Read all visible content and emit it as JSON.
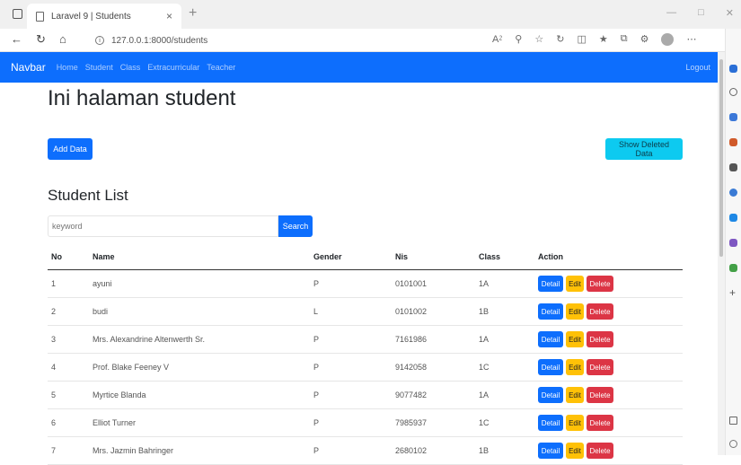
{
  "browser": {
    "tab_title": "Laravel 9 | Students",
    "tab_close": "×",
    "new_tab": "+",
    "url": "127.0.0.1:8000/students"
  },
  "navbar": {
    "brand": "Navbar",
    "links": [
      "Home",
      "Student",
      "Class",
      "Extracurricular",
      "Teacher"
    ],
    "logout": "Logout"
  },
  "page": {
    "title": "Ini halaman student",
    "add_button": "Add Data",
    "deleted_button": "Show Deleted Data",
    "section_title": "Student List",
    "search_placeholder": "keyword",
    "search_button": "Search"
  },
  "table": {
    "headers": [
      "No",
      "Name",
      "Gender",
      "Nis",
      "Class",
      "Action"
    ],
    "actions": {
      "detail": "Detail",
      "edit": "Edit",
      "delete": "Delete"
    },
    "rows": [
      [
        "1",
        "ayuni",
        "P",
        "0101001",
        "1A"
      ],
      [
        "2",
        "budi",
        "L",
        "0101002",
        "1B"
      ],
      [
        "3",
        "Mrs. Alexandrine Altenwerth Sr.",
        "P",
        "7161986",
        "1A"
      ],
      [
        "4",
        "Prof. Blake Feeney V",
        "P",
        "9142058",
        "1C"
      ],
      [
        "5",
        "Myrtice Blanda",
        "P",
        "9077482",
        "1A"
      ],
      [
        "6",
        "Elliot Turner",
        "P",
        "7985937",
        "1C"
      ],
      [
        "7",
        "Mrs. Jazmin Bahringer",
        "P",
        "2680102",
        "1B"
      ]
    ]
  },
  "colors": {
    "primary": "#0d6efd",
    "info": "#0dcaf0",
    "warning": "#ffc107",
    "danger": "#dc3545"
  }
}
